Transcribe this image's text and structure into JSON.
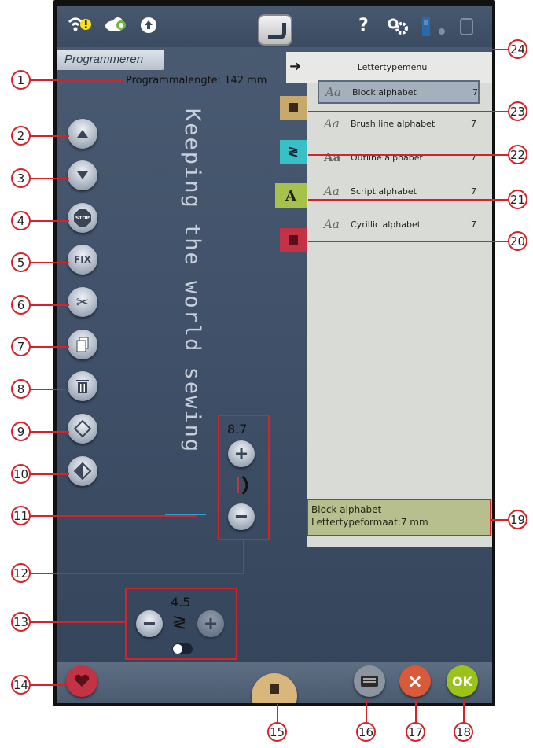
{
  "topbar": {
    "wifi_icon": "wifi-warning-icon",
    "cloud_icon": "cloud-sync-icon",
    "upload_icon": "upload-icon",
    "home_icon": "home-icon",
    "help_label": "?",
    "settings_icon": "gear-icon"
  },
  "mode": {
    "label": "Programmeren"
  },
  "program": {
    "length_text": "Programmalengte: 142 mm"
  },
  "left_buttons": {
    "up": "arrow-up-icon",
    "down": "arrow-down-icon",
    "stop_label": "STOP",
    "fix_label": "FIX"
  },
  "sewn_text": "Keeping the world sewing",
  "font_menu": {
    "title": "Lettertypemenu",
    "items": [
      {
        "preview": "Aa",
        "name": "Block alphabet",
        "count": "7",
        "selected": true
      },
      {
        "preview": "Aa",
        "name": "Brush line alphabet",
        "count": "7"
      },
      {
        "preview": "Aa",
        "name": "Outline alphabet",
        "count": "7"
      },
      {
        "preview": "Aa",
        "name": "Script alphabet",
        "count": "7"
      },
      {
        "preview": "Aa",
        "name": "Cyrillic alphabet",
        "count": "7"
      }
    ]
  },
  "tabs": {
    "alphabet_label": "A"
  },
  "info": {
    "font_name": "Block alphabet",
    "font_size": "Lettertypeformaat:7 mm"
  },
  "width_control": {
    "value": "8.7"
  },
  "stitch_control": {
    "value": "4.5"
  },
  "bottom": {
    "ok_label": "OK",
    "cancel_symbol": "×"
  },
  "callouts": [
    "1",
    "2",
    "3",
    "4",
    "5",
    "6",
    "7",
    "8",
    "9",
    "10",
    "11",
    "12",
    "13",
    "14",
    "15",
    "16",
    "17",
    "18",
    "19",
    "20",
    "21",
    "22",
    "23",
    "24"
  ],
  "colors": {
    "callout_red": "#d6232a",
    "ok_green": "#9ac21a",
    "cancel_red": "#d85a3a",
    "heart_red": "#c43345",
    "tab_gold": "#c9a86c",
    "tab_teal": "#37c0c6",
    "tab_green": "#a7c24a",
    "tab_red": "#c43345",
    "info_bg": "#b8bf8e"
  }
}
